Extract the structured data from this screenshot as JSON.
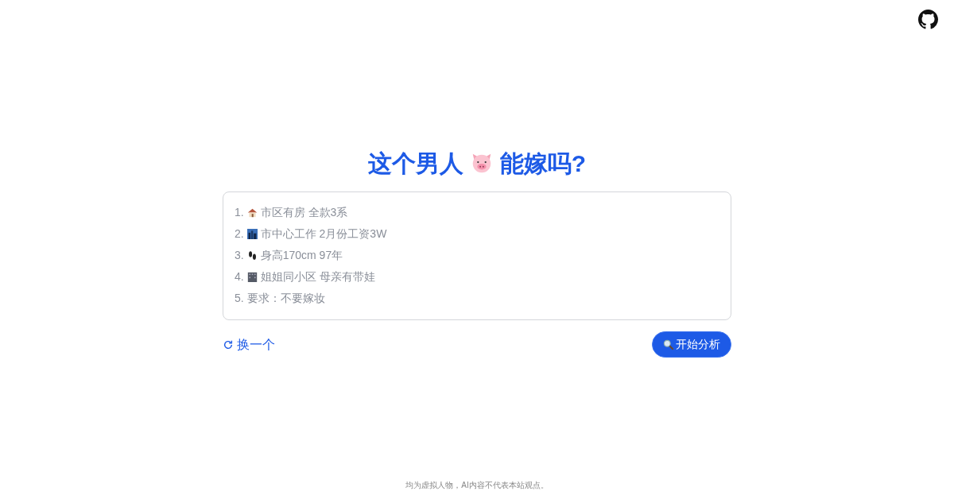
{
  "title": {
    "before": "这个男人",
    "after": "能嫁吗?"
  },
  "prompt_lines": [
    {
      "number": "1.",
      "kind": "house",
      "text": "市区有房 全款3系"
    },
    {
      "number": "2.",
      "kind": "city",
      "text": "市中心工作 2月份工资3W"
    },
    {
      "number": "3.",
      "kind": "footprints",
      "text": "身高170cm 97年"
    },
    {
      "number": "4.",
      "kind": "building",
      "text": "姐姐同小区 母亲有带娃"
    },
    {
      "number": "5.",
      "text": "要求：不要嫁妆"
    }
  ],
  "refresh_link": "换一个",
  "analyze_button": "开始分析",
  "footer": "均为虚拟人物，AI内容不代表本站观点。"
}
